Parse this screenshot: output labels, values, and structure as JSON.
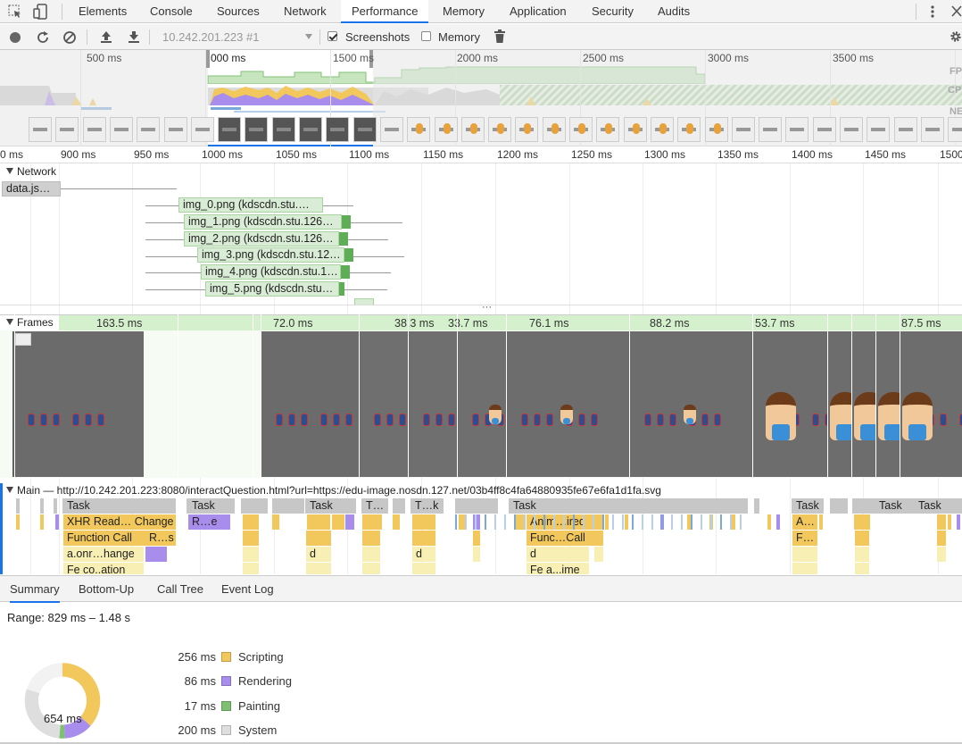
{
  "tabs": [
    {
      "label": "Elements",
      "active": false
    },
    {
      "label": "Console",
      "active": false
    },
    {
      "label": "Sources",
      "active": false
    },
    {
      "label": "Network",
      "active": false
    },
    {
      "label": "Performance",
      "active": true
    },
    {
      "label": "Memory",
      "active": false
    },
    {
      "label": "Application",
      "active": false
    },
    {
      "label": "Security",
      "active": false
    },
    {
      "label": "Audits",
      "active": false
    }
  ],
  "toolbar": {
    "profile_select": "10.242.201.223 #1",
    "screenshots_label": "Screenshots",
    "screenshots_checked": true,
    "memory_label": "Memory",
    "memory_checked": false
  },
  "overview": {
    "ticks": [
      "500 ms",
      "000 ms",
      "1500 ms",
      "2000 ms",
      "2500 ms",
      "3000 ms",
      "3500 ms"
    ],
    "track_labels": [
      "FPS",
      "CPU",
      "NET"
    ]
  },
  "ruler": [
    "0 ms",
    "900 ms",
    "950 ms",
    "1000 ms",
    "1050 ms",
    "1100 ms",
    "1150 ms",
    "1200 ms",
    "1250 ms",
    "1300 ms",
    "1350 ms",
    "1400 ms",
    "1450 ms",
    "1500"
  ],
  "network": {
    "title": "Network",
    "requests": [
      "data.js…",
      "img_0.png (kdscdn.stu.…",
      "img_1.png (kdscdn.stu.126…",
      "img_2.png (kdscdn.stu.126…",
      "img_3.png (kdscdn.stu.12…",
      "img_4.png (kdscdn.stu.1…",
      "img_5.png (kdscdn.stu…"
    ]
  },
  "frames": {
    "title": "Frames",
    "durations": [
      "163.5 ms",
      "72.0 ms",
      "38.3 ms",
      "33.7 ms",
      "76.1 ms",
      "88.2 ms",
      "53.7 ms",
      "87.5 ms"
    ]
  },
  "main": {
    "title": "Main — http://10.242.201.223:8080/interactQuestion.html?url=https://edu-image.nosdn.127.net/03b4ff8c4fa64880935fe67e6fa1d1fa.svg",
    "row1": [
      "Task",
      "Task",
      "Task",
      "T…",
      "T…k",
      "Task",
      "Task",
      "Task",
      "Task"
    ],
    "row2": [
      "XHR Read… Change",
      "R…e",
      "Anim…ired",
      "A…"
    ],
    "row3": [
      "Function Call",
      "R…s",
      "Func…Call",
      "F…"
    ],
    "row4": [
      "a.onr…hange",
      "d",
      "d",
      "d"
    ],
    "row5": [
      "Fe co..ation",
      "Fe a...ime"
    ]
  },
  "bottom_tabs": [
    {
      "label": "Summary",
      "active": true
    },
    {
      "label": "Bottom-Up",
      "active": false
    },
    {
      "label": "Call Tree",
      "active": false
    },
    {
      "label": "Event Log",
      "active": false
    }
  ],
  "summary": {
    "range": "Range: 829 ms – 1.48 s",
    "total": "654 ms",
    "items": [
      {
        "value": "256 ms",
        "label": "Scripting",
        "color": "#f2c75c",
        "ms": 256
      },
      {
        "value": "86 ms",
        "label": "Rendering",
        "color": "#a88dec",
        "ms": 86
      },
      {
        "value": "17 ms",
        "label": "Painting",
        "color": "#7fbf72",
        "ms": 17
      },
      {
        "value": "200 ms",
        "label": "System",
        "color": "#dedede",
        "ms": 200
      }
    ]
  }
}
